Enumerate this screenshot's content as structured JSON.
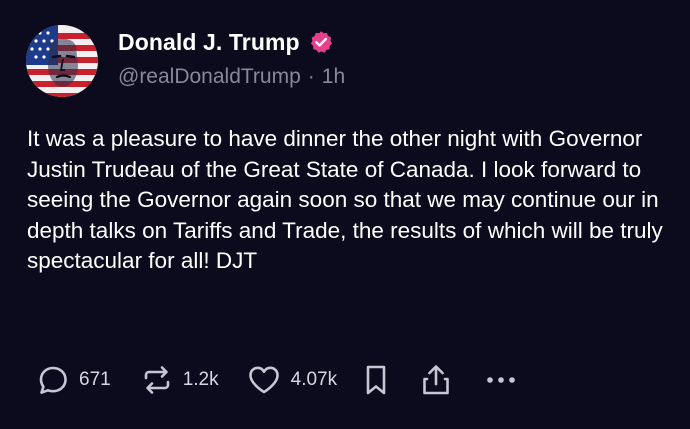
{
  "author": {
    "display_name": "Donald J. Trump",
    "handle": "@realDonaldTrump",
    "separator": "·",
    "timestamp": "1h",
    "verified_badge_color": "#e5408a"
  },
  "post": {
    "text": "It was a pleasure to have dinner the other night with Governor Justin Trudeau of the Great State of Canada. I look forward to seeing the Governor again soon so that we may continue our in depth talks on Tariffs and Trade, the results of which will be truly spectacular for all! DJT"
  },
  "actions": {
    "replies": "671",
    "reposts": "1.2k",
    "likes": "4.07k"
  },
  "icons": [
    "reply-icon",
    "repost-icon",
    "heart-icon",
    "bookmark-icon",
    "share-icon",
    "more-icon",
    "verified-icon"
  ],
  "colors": {
    "background": "#0c0a1d",
    "text": "#ffffff",
    "muted": "#8a8799",
    "icon": "#c9c6d4"
  }
}
